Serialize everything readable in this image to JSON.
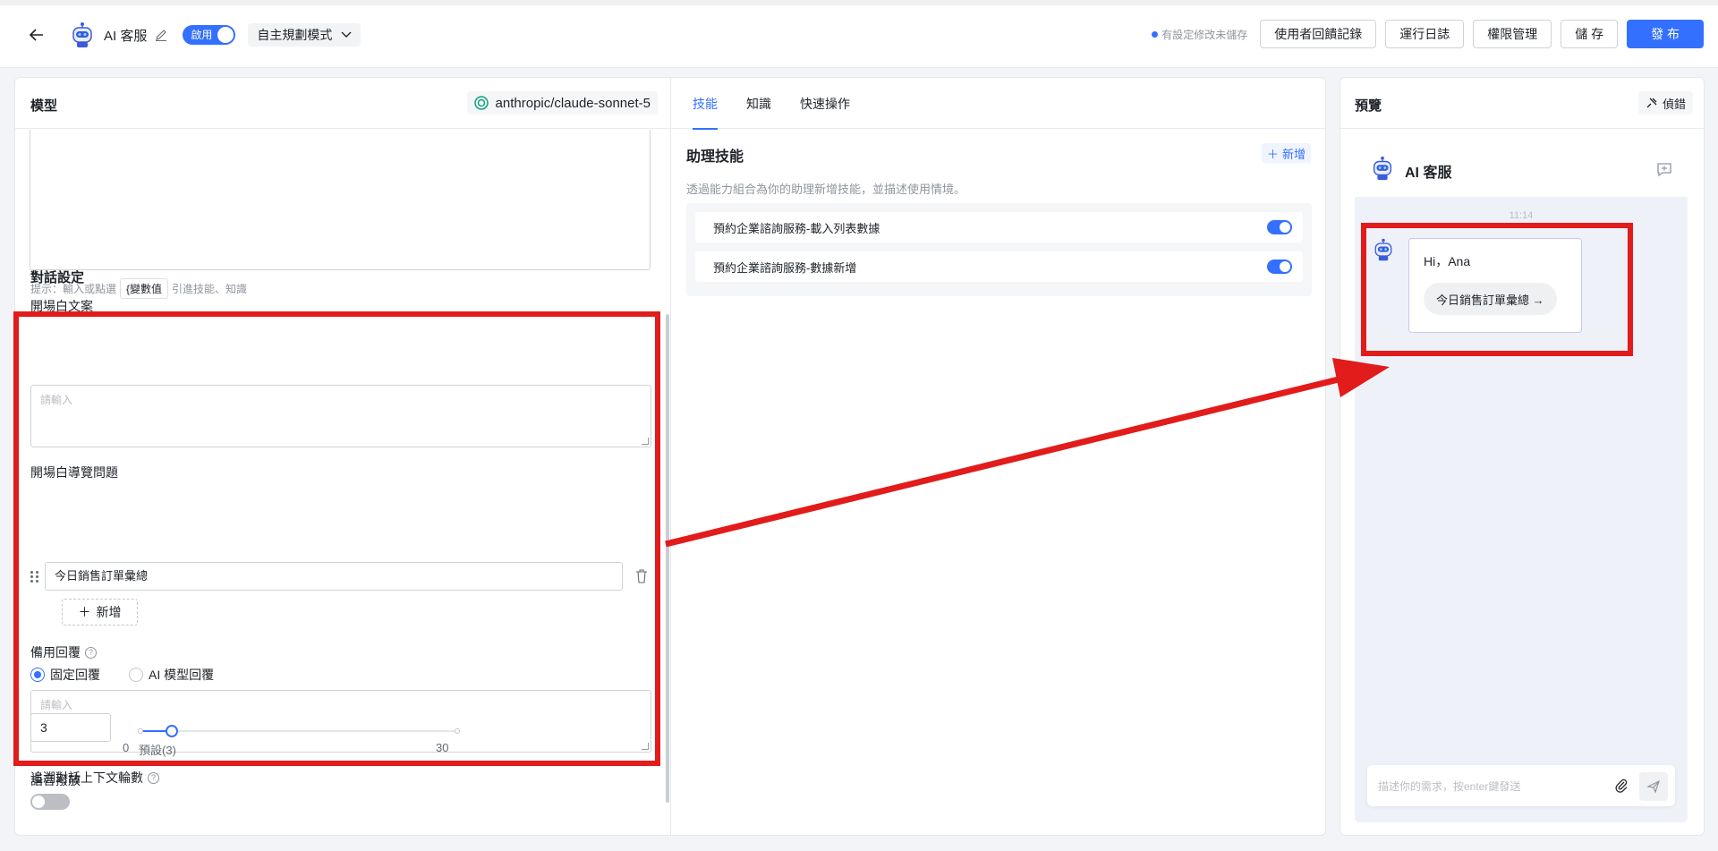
{
  "header": {
    "app_name": "AI 客服",
    "enable_label": "啟用",
    "mode_label": "自主規劃模式",
    "unsaved_hint": "有設定修改未儲存",
    "buttons": {
      "feedback": "使用者回饋記錄",
      "logs": "運行日誌",
      "permissions": "權限管理",
      "save": "儲 存",
      "publish": "發 布"
    }
  },
  "model_panel": {
    "title": "模型",
    "model_name": "anthropic/claude-sonnet-5",
    "hint_prefix": "提示：輸入或點選",
    "var_chip": "{變數值",
    "hint_suffix": "引進技能、知識",
    "conversation": {
      "title": "對話設定",
      "opening_text_label": "開場白文案",
      "opening_text_placeholder": "請輸入",
      "opening_questions_label": "開場白導覽問題",
      "opening_question_value": "今日銷售訂單彙總",
      "add_label": "新增",
      "fallback_label": "備用回覆",
      "radio_fixed": "固定回覆",
      "radio_ai": "AI 模型回覆",
      "fallback_placeholder": "請輸入",
      "context_rounds_label": "追溯對話上下文輪數",
      "context_rounds_value": "3",
      "slider_min": "0",
      "slider_default": "預設(3)",
      "slider_max": "30",
      "slider_value_fraction": 0.1
    },
    "voice_label": "語音撥放"
  },
  "skills_panel": {
    "tabs": [
      "技能",
      "知識",
      "快速操作"
    ],
    "active_tab": 0,
    "title": "助理技能",
    "add_label": "新增",
    "description": "透過能力組合為你的助理新增技能，並描述使用情境。",
    "skills": [
      {
        "name": "預約企業諮詢服務-載入列表數據",
        "enabled": true
      },
      {
        "name": "預約企業諮詢服務-數據新增",
        "enabled": true
      }
    ]
  },
  "preview_panel": {
    "title": "預覽",
    "debug_label": "偵錯",
    "chat_title": "AI 客服",
    "time": "11:14",
    "greeting": "Hi，Ana",
    "suggested_question": "今日銷售訂單彙總 →",
    "input_placeholder": "描述你的需求，按enter鍵發送"
  },
  "colors": {
    "accent": "#3370ff",
    "highlight": "#e21b1b"
  }
}
